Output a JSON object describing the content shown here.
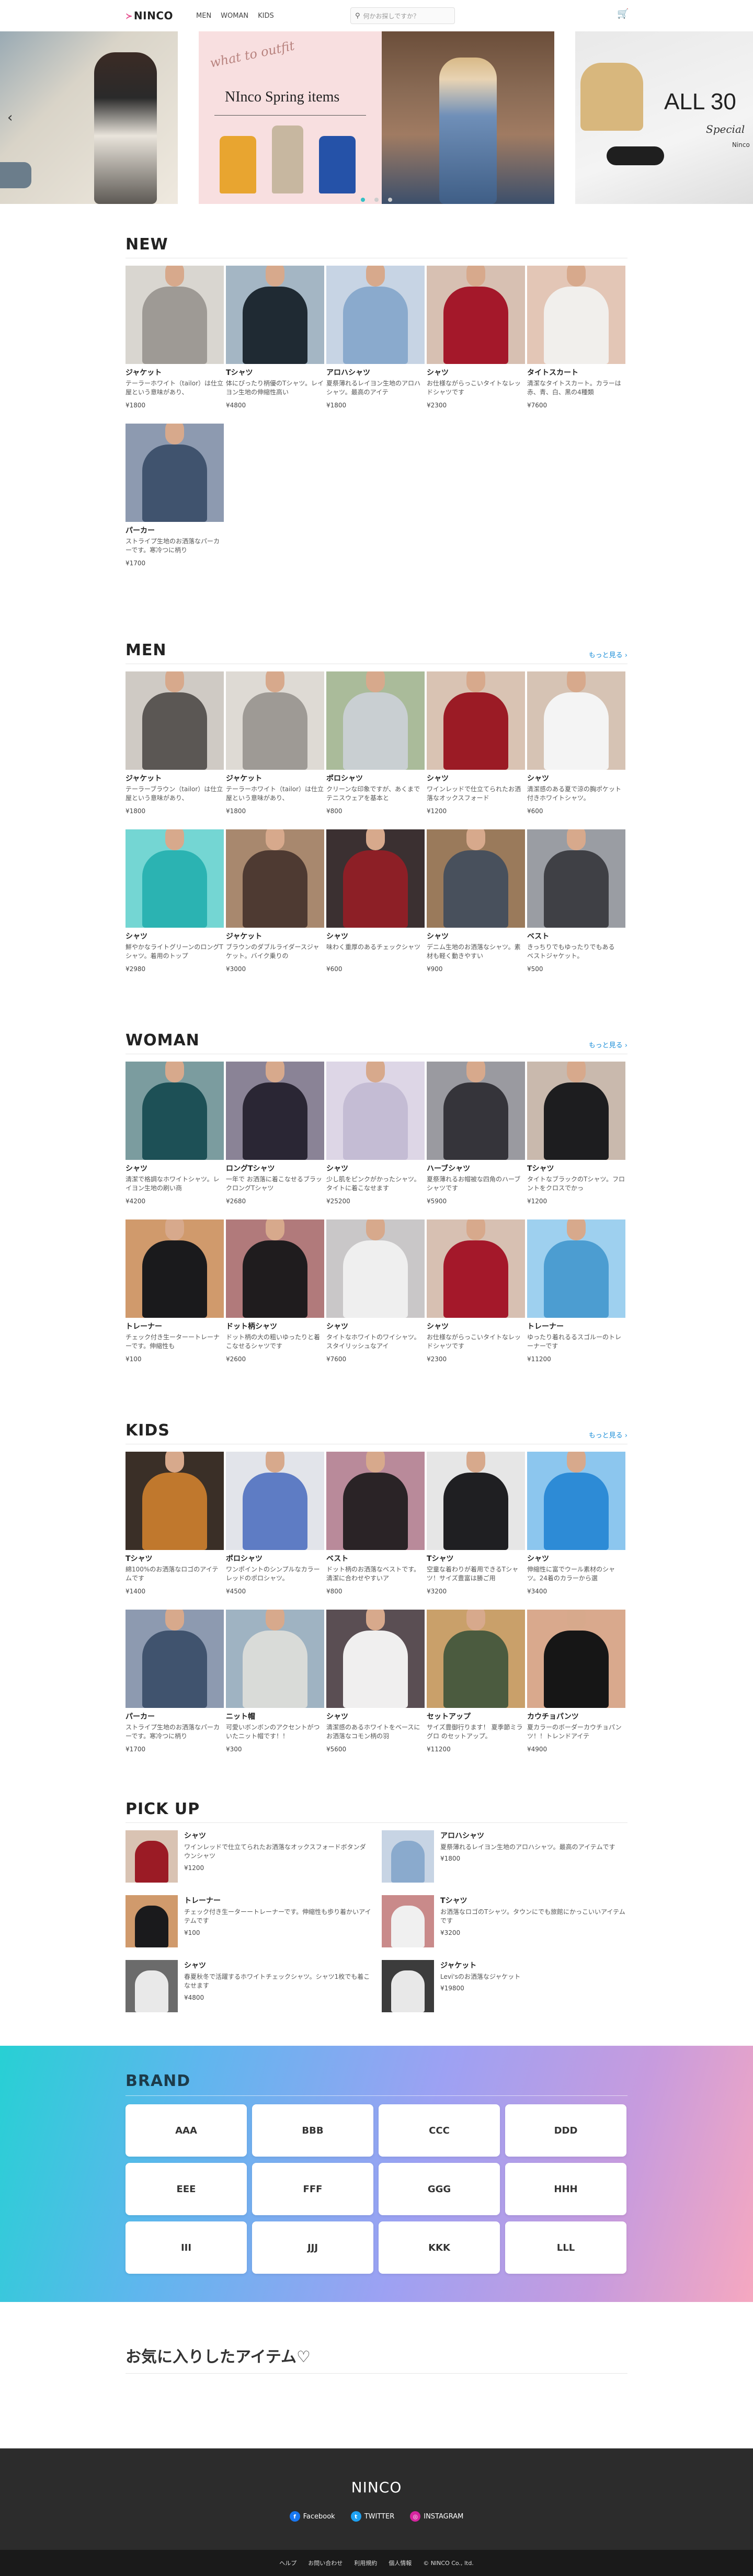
{
  "header": {
    "logo": "NINCO",
    "nav": [
      "MEN",
      "WOMAN",
      "KIDS"
    ],
    "search_placeholder": "何かお探しですか？"
  },
  "carousel": {
    "slide_center": {
      "cursive": "what to outfit",
      "title": "NInco Spring items"
    },
    "slide_right": {
      "title": "ALL 30",
      "subtitle": "Special",
      "brand": "Ninco"
    }
  },
  "sections": {
    "new": {
      "title": "NEW",
      "items": [
        {
          "name": "ジャケット",
          "desc": "テーラーホワイト（tailor）は仕立屋という意味があり、",
          "price": "¥1800",
          "c1": "#9e9a95",
          "c2": "#d9d6d0"
        },
        {
          "name": "Tシャツ",
          "desc": "体にぴったり柄優のTシャツ。レイヨン生地の伸縮性高い",
          "price": "¥4800",
          "c1": "#1f2a33",
          "c2": "#a4b6c4"
        },
        {
          "name": "アロハシャツ",
          "desc": "夏祭薄れるレイヨン生地のアロハシャツ。最高のアイテ",
          "price": "¥1800",
          "c1": "#8aaacd",
          "c2": "#c7d4e4"
        },
        {
          "name": "シャツ",
          "desc": "お仕様ながらっこいタイトなレッドシャツです",
          "price": "¥2300",
          "c1": "#a4182a",
          "c2": "#d7c0b2"
        },
        {
          "name": "タイトスカート",
          "desc": "清潔なタイトスカート。カラーは赤、青、白、黒の4種類",
          "price": "¥7600",
          "c1": "#f1efec",
          "c2": "#e3c6b6"
        },
        {
          "name": "パーカー",
          "desc": "ストライプ生地のお洒落なパーカーです。寒冷つに柄り",
          "price": "¥1700",
          "c1": "#40536e",
          "c2": "#8d9ab0"
        }
      ]
    },
    "men": {
      "title": "MEN",
      "more": "もっと見る ›",
      "items": [
        {
          "name": "ジャケット",
          "desc": "テーラーブラウン（tailor）は仕立屋という意味があり、",
          "price": "¥1800",
          "c1": "#5b5754",
          "c2": "#cfcac4"
        },
        {
          "name": "ジャケット",
          "desc": "テーラーホワイト（tailor）は仕立屋という意味があり、",
          "price": "¥1800",
          "c1": "#9e9a95",
          "c2": "#dedad4"
        },
        {
          "name": "ポロシャツ",
          "desc": "クリーンな印象ですが、あくまでテニスウェアを基本と",
          "price": "¥800",
          "c1": "#c9cfd2",
          "c2": "#aabb9a"
        },
        {
          "name": "シャツ",
          "desc": "ワインレッドで仕立てられたお洒落なオックスフォード",
          "price": "¥1200",
          "c1": "#9b1b25",
          "c2": "#d9c3b3"
        },
        {
          "name": "シャツ",
          "desc": "清潔感のある夏で涼の胸ポケット付きホワイトシャツ。",
          "price": "¥600",
          "c1": "#f4f4f4",
          "c2": "#d6c3b4"
        },
        {
          "name": "シャツ",
          "desc": "鮮やかなライトグリーンのロングTシャツ。着用のトップ",
          "price": "¥2980",
          "c1": "#2bb3b2",
          "c2": "#74d6d3"
        },
        {
          "name": "ジャケット",
          "desc": "ブラウンのダブルライダースジャケット。バイク乗りの",
          "price": "¥3000",
          "c1": "#4e3a32",
          "c2": "#a8886e"
        },
        {
          "name": "シャツ",
          "desc": "味わく重厚のあるチェックシャツ",
          "price": "¥600",
          "c1": "#8d1f26",
          "c2": "#3b3031"
        },
        {
          "name": "シャツ",
          "desc": "デニム生地のお洒落なシャツ。素材も軽く動きやすい",
          "price": "¥900",
          "c1": "#48505c",
          "c2": "#9a7a5b"
        },
        {
          "name": "ベスト",
          "desc": "きっちりでもゆったりでもある　ベストジャケット。",
          "price": "¥500",
          "c1": "#3f4045",
          "c2": "#9a9da3"
        }
      ]
    },
    "woman": {
      "title": "WOMAN",
      "more": "もっと見る ›",
      "items": [
        {
          "name": "シャツ",
          "desc": "清潔で格調なホワイトシャツ。レイヨン生地の刷い商",
          "price": "¥4200",
          "c1": "#1d5056",
          "c2": "#7b9c9f"
        },
        {
          "name": "ロングTシャツ",
          "desc": "一年で お洒落に着こなせるブラックロングTシャツ",
          "price": "¥2680",
          "c1": "#2a2634",
          "c2": "#8a8396"
        },
        {
          "name": "シャツ",
          "desc": "少し肌をピンクがかったシャツ。タイトに着こなせます",
          "price": "¥25200",
          "c1": "#c4bcd4",
          "c2": "#ddd6e6"
        },
        {
          "name": "ハーブシャツ",
          "desc": "夏祭薄れるお帽被な四角のハーブシャツです",
          "price": "¥5900",
          "c1": "#35343a",
          "c2": "#9a9aa0"
        },
        {
          "name": "Tシャツ",
          "desc": "タイトなブラックのTシャツ。フロントをクロスでかっ",
          "price": "¥1200",
          "c1": "#1d1d1f",
          "c2": "#c9b9ad"
        },
        {
          "name": "トレーナー",
          "desc": "チェック付き生ーターートレーナーです。伸縮性も",
          "price": "¥100",
          "c1": "#1a1a1c",
          "c2": "#d09a6c"
        },
        {
          "name": "ドット柄シャツ",
          "desc": "ドット柄の大の粗いゆったりと着こなせるシャツです",
          "price": "¥2600",
          "c1": "#1f1c1e",
          "c2": "#b17a7b"
        },
        {
          "name": "シャツ",
          "desc": "タイトなホワイトのワイシャツ。スタイリッシュなアイ",
          "price": "¥7600",
          "c1": "#efefef",
          "c2": "#c9c7c8"
        },
        {
          "name": "シャツ",
          "desc": "お仕様ながらっこいタイトなレッドシャツです",
          "price": "¥2300",
          "c1": "#a4182a",
          "c2": "#d7c0b2"
        },
        {
          "name": "トレーナー",
          "desc": "ゆったり着れるるスゴルーのトレーナーです",
          "price": "¥11200",
          "c1": "#4c9dd1",
          "c2": "#9ed0ef"
        }
      ]
    },
    "kids": {
      "title": "KIDS",
      "more": "もっと見る ›",
      "items": [
        {
          "name": "Tシャツ",
          "desc": "綿100%のお洒落なロゴのアイテムです",
          "price": "¥1400",
          "c1": "#c0782d",
          "c2": "#3a2f27"
        },
        {
          "name": "ポロシャツ",
          "desc": "ワンポイントのシンプルなカラーレッドのポロシャツ。",
          "price": "¥4500",
          "c1": "#5e7cc4",
          "c2": "#e2e4ea"
        },
        {
          "name": "ベスト",
          "desc": "ドット柄のお洒落なベストです。清潔に合わせやすいア",
          "price": "¥800",
          "c1": "#2a2326",
          "c2": "#b98a9a"
        },
        {
          "name": "Tシャツ",
          "desc": "空童な着わりが着用できるTシャツ！サイズ豊富は勝ご用",
          "price": "¥3200",
          "c1": "#1f1f22",
          "c2": "#e6e6e6"
        },
        {
          "name": "シャツ",
          "desc": "伸縮性に富でウール素材のシャツ。24着のカラーから選",
          "price": "¥3400",
          "c1": "#2d8bd6",
          "c2": "#8cc6ee"
        },
        {
          "name": "パーカー",
          "desc": "ストライプ生地のお洒落なパーカーです。寒冷つに柄り",
          "price": "¥1700",
          "c1": "#40536e",
          "c2": "#8d9ab0"
        },
        {
          "name": "ニット帽",
          "desc": "可愛いボンボンのアクセントがついたニット帽です！！",
          "price": "¥300",
          "c1": "#d9dbd8",
          "c2": "#9fb3c2"
        },
        {
          "name": "シャツ",
          "desc": "清潔感のあるホワイトをベースにお洒落なコモン柄の羽",
          "price": "¥5600",
          "c1": "#f0efef",
          "c2": "#5a4e53"
        },
        {
          "name": "セットアップ",
          "desc": "サイズ豊御行ります！ 夏季節ミラグロ のセットアップ。",
          "price": "¥11200",
          "c1": "#4b5b3f",
          "c2": "#c9a06a"
        },
        {
          "name": "カウチョパンツ",
          "desc": "夏カラーのボーダーカウチョパンツ！！トレンドアイテ",
          "price": "¥4900",
          "c1": "#161616",
          "c2": "#d9a98d"
        }
      ]
    }
  },
  "pickup": {
    "title": "PICK UP",
    "items": [
      {
        "name": "シャツ",
        "desc": "ワインレッドで仕立てられたお洒落なオックスフォードボタンダウンシャツ",
        "price": "¥1200",
        "c1": "#9b1b25",
        "c2": "#d9c3b3"
      },
      {
        "name": "アロハシャツ",
        "desc": "夏祭薄れるレイヨン生地のアロハシャツ。最高のアイテムです",
        "price": "¥1800",
        "c1": "#8aaacd",
        "c2": "#c7d4e4"
      },
      {
        "name": "トレーナー",
        "desc": "チェック付き生ーターートレーナーです。伸縮性も歩り着かいアイテムです",
        "price": "¥100",
        "c1": "#1a1a1c",
        "c2": "#d09a6c"
      },
      {
        "name": "Tシャツ",
        "desc": "お洒落なロゴのTシャツ。タウンにでも旅館にかっこいいアイテムです",
        "price": "¥3200",
        "c1": "#f0f0f0",
        "c2": "#c98a8a"
      },
      {
        "name": "シャツ",
        "desc": "春夏秋冬で活躍するホワイトチェックシャツ。シャツ1枚でも着こなせます",
        "price": "¥4800",
        "c1": "#e9e9e9",
        "c2": "#6b6b6b"
      },
      {
        "name": "ジャケット",
        "desc": "Levi'sのお洒落なジャケット",
        "price": "¥19800",
        "c1": "#e8e8e8",
        "c2": "#3c3c3c"
      }
    ]
  },
  "brand": {
    "title": "BRAND",
    "items": [
      "AAA",
      "BBB",
      "CCC",
      "DDD",
      "EEE",
      "FFF",
      "GGG",
      "HHH",
      "III",
      "JJJ",
      "KKK",
      "LLL"
    ]
  },
  "favorites": {
    "title": "お気に入りしたアイテム♡"
  },
  "footer": {
    "logo": "NINCO",
    "social": [
      {
        "label": "Facebook",
        "icon": "facebook-icon",
        "color": "#1877f2",
        "glyph": "f"
      },
      {
        "label": "TWITTER",
        "icon": "twitter-icon",
        "color": "#1da1f2",
        "glyph": "t"
      },
      {
        "label": "INSTAGRAM",
        "icon": "instagram-icon",
        "color": "#d6249f",
        "glyph": "◎"
      }
    ],
    "links": [
      "ヘルプ",
      "お問い合わせ",
      "利用規約",
      "個人情報",
      "© NINCO Co., ltd."
    ]
  },
  "colors": {
    "accent": "#35c0c5",
    "link": "#1b8ed8",
    "footer_bg": "#2c2c2c"
  }
}
